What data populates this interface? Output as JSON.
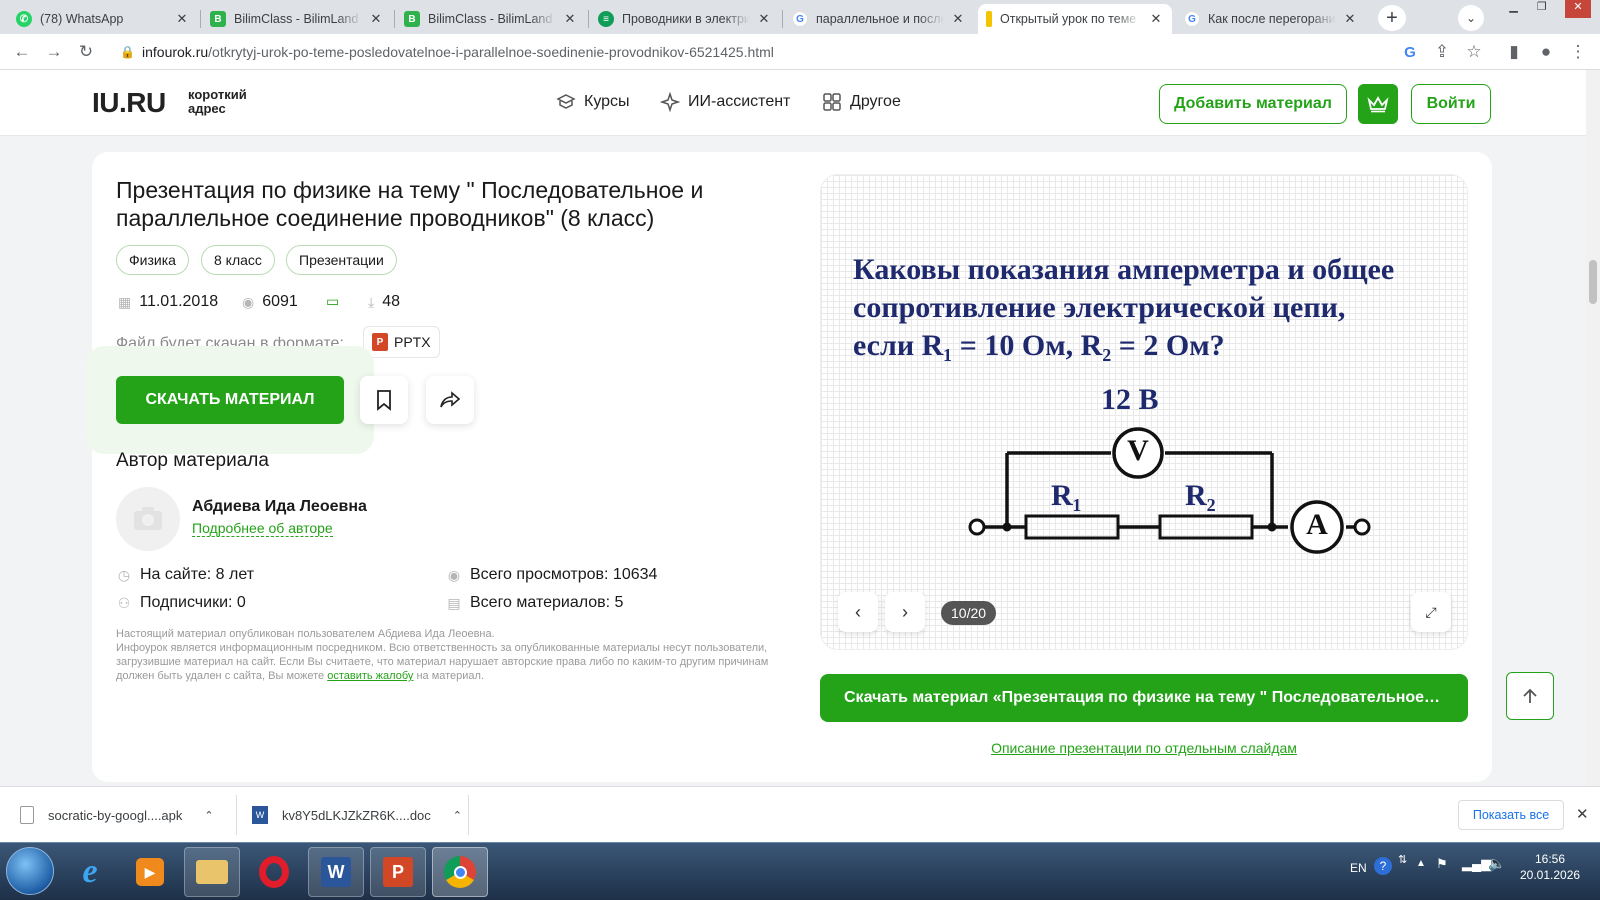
{
  "browser": {
    "tabs": [
      {
        "title": "(78) WhatsApp",
        "favicon": "whatsapp-icon",
        "color": "#25d366"
      },
      {
        "title": "BilimClass - BilimLand",
        "favicon": "bilimland-icon",
        "color": "#2fb24c"
      },
      {
        "title": "BilimClass - BilimLand",
        "favicon": "bilimland-icon",
        "color": "#2fb24c"
      },
      {
        "title": "Проводники в электрических",
        "favicon": "doc-icon",
        "color": "#0f9d58"
      },
      {
        "title": "параллельное и последовательное",
        "favicon": "google-icon",
        "color": "#4285f4"
      },
      {
        "title": "Открытый урок по теме",
        "favicon": "infourok-icon",
        "color": "#f5c400"
      },
      {
        "title": "Как после перегорания",
        "favicon": "google-icon",
        "color": "#4285f4"
      }
    ],
    "url_domain": "infourok.ru",
    "url_path": "/otkrytyj-urok-po-teme-posledovatelnoe-i-parallelnoe-soedinenie-provodnikov-6521425.html"
  },
  "header": {
    "logo": "IU.RU",
    "logo_sub_1": "короткий",
    "logo_sub_2": "адрес",
    "nav": [
      "Курсы",
      "ИИ-ассистент",
      "Другое"
    ],
    "add_material": "Добавить материал",
    "login": "Войти"
  },
  "material": {
    "title": "Презентация по физике на тему \" Последовательное и параллельное соединение проводников\" (8 класс)",
    "chips": [
      "Физика",
      "8 класс",
      "Презентации"
    ],
    "date": "11.01.2018",
    "views": "6091",
    "downloads": "48",
    "format_label": "Файл будет скачан в формате:",
    "format": "PPTX",
    "download_button": "СКАЧАТЬ МАТЕРИАЛ"
  },
  "author": {
    "heading": "Автор материала",
    "name": "Абдиева Ида Леоевна",
    "more_link": "Подробнее об авторе",
    "on_site": "На сайте: 8 лет",
    "subscribers": "Подписчики: 0",
    "total_views": "Всего просмотров: 10634",
    "total_materials": "Всего материалов: 5"
  },
  "disclaimer": {
    "text_1": "Настоящий материал опубликован пользователем Абдиева Ида Леоевна.",
    "text_2": "Инфоурок является информационным посредником. Всю ответственность за опубликованные материалы несут пользователи, загрузившие материал на сайт. Если Вы считаете, что материал нарушает авторские права либо по каким-то другим причинам должен быть удален с сайта, Вы можете",
    "link": "оставить жалобу",
    "text_3": "на материал."
  },
  "slide": {
    "line1": "Каковы показания амперметра и общее",
    "line2": "сопротивление электрической  цепи,",
    "line3": "если R₁ = 10 Ом, R₂ = 2 Ом?",
    "voltage": "12 В",
    "r1": "R₁",
    "r2": "R₂",
    "voltmeter": "V",
    "ammeter": "A",
    "counter": "10/20"
  },
  "download_full": "Скачать материал «Презентация по физике на тему \" Последовательное и параллельное соединение проводников\" (8 класс)»",
  "slides_description_link": "Описание презентации по отдельным слайдам",
  "downloads_bar": {
    "items": [
      "socratic-by-googl....apk",
      "kv8Y5dLKJZkZR6K....doc"
    ],
    "show_all": "Показать все"
  },
  "taskbar": {
    "lang": "EN",
    "time": "16:56",
    "date": "20.01.2026"
  },
  "colors": {
    "accent": "#24a319",
    "slide_text": "#1f2a6e"
  }
}
